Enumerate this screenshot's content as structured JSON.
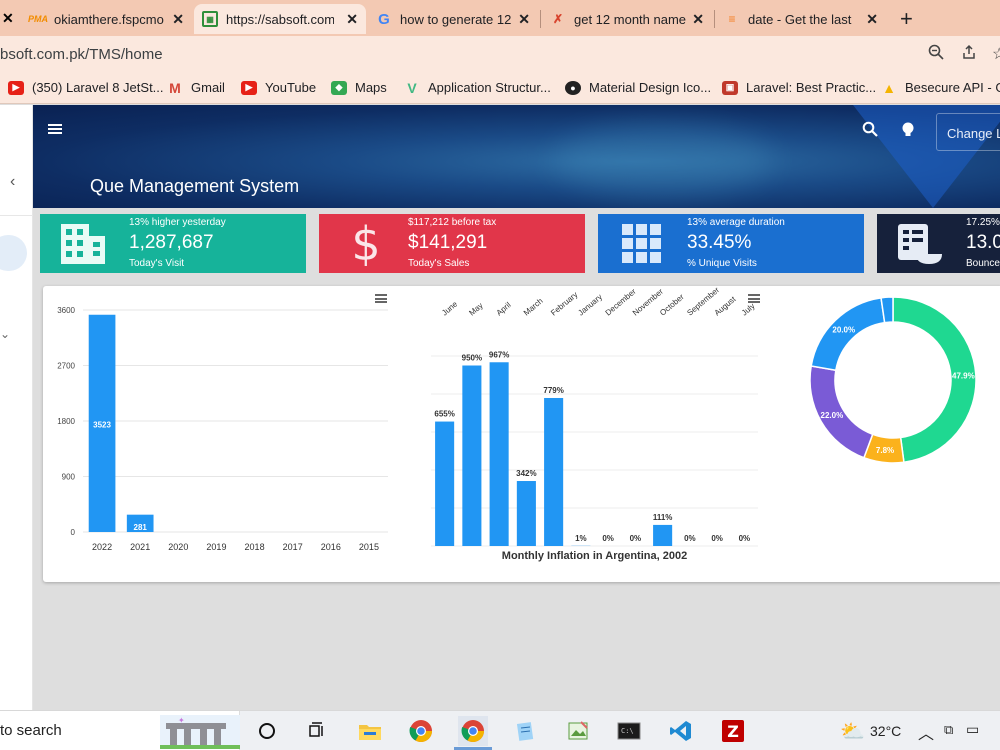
{
  "browser": {
    "tabs": [
      {
        "label": "okiamthere.fspcmo",
        "icon": "phpmyadmin-icon",
        "active": false
      },
      {
        "label": "https://sabsoft.com",
        "icon": "site-icon",
        "active": true
      },
      {
        "label": "how to generate 12",
        "icon": "google-icon",
        "active": false
      },
      {
        "label": "get 12 month name",
        "icon": "stackoverflow-icon",
        "active": false
      },
      {
        "label": "date - Get the last",
        "icon": "stackoverflow-icon",
        "active": false
      }
    ],
    "url": "bsoft.com.pk/TMS/home",
    "bookmarks": [
      {
        "label": "(350) Laravel 8 JetSt...",
        "icon": "youtube-icon",
        "color": "#e62117"
      },
      {
        "label": "Gmail",
        "icon": "gmail-icon",
        "color": "#d44638"
      },
      {
        "label": "YouTube",
        "icon": "youtube-icon",
        "color": "#e62117"
      },
      {
        "label": "Maps",
        "icon": "maps-icon",
        "color": "#34a853"
      },
      {
        "label": "Application Structur...",
        "icon": "vue-icon",
        "color": "#41b883"
      },
      {
        "label": "Material Design Ico...",
        "icon": "github-icon",
        "color": "#222222"
      },
      {
        "label": "Laravel: Best Practic...",
        "icon": "laravel-icon",
        "color": "#c0392b"
      },
      {
        "label": "Besecure API - Go",
        "icon": "drive-icon",
        "color": "#f4b400"
      }
    ]
  },
  "header": {
    "title": "Que Management System",
    "change_label": "Change L"
  },
  "cards": [
    {
      "top": "13% higher yesterday",
      "value": "1,287,687",
      "label": "Today's Visit",
      "color": "#16b39a",
      "icon": "building-icon"
    },
    {
      "top": "$117,212 before tax",
      "value": "$141,291",
      "label": "Today's Sales",
      "color": "#e1364a",
      "icon": "dollar-icon"
    },
    {
      "top": "13% average duration",
      "value": "33.45%",
      "label": "% Unique Visits",
      "color": "#1a6fd0",
      "icon": "grid-icon"
    },
    {
      "top": "17.25%",
      "value": "13.0",
      "label": "Bounce",
      "color": "#16213b",
      "icon": "receipt-icon"
    }
  ],
  "chart_data": [
    {
      "type": "bar",
      "categories": [
        "2022",
        "2021",
        "2020",
        "2019",
        "2018",
        "2017",
        "2016",
        "2015"
      ],
      "values": [
        3523,
        281,
        0,
        0,
        0,
        0,
        0,
        0
      ],
      "data_labels": [
        "3523",
        "281",
        "",
        "",
        "",
        "",
        "",
        ""
      ],
      "ytick_labels": [
        "0",
        "900",
        "1800",
        "2700",
        "3600"
      ],
      "ylim": [
        0,
        3600
      ],
      "color": "#2196f3",
      "grid": true
    },
    {
      "type": "bar",
      "title": "Monthly Inflation in Argentina, 2002",
      "categories": [
        "June",
        "May",
        "April",
        "March",
        "February",
        "January",
        "December",
        "November",
        "October",
        "September",
        "August",
        "July"
      ],
      "values": [
        655,
        950,
        967,
        342,
        779,
        1,
        0,
        0,
        111,
        0,
        0,
        0
      ],
      "data_labels": [
        "655%",
        "950%",
        "967%",
        "342%",
        "779%",
        "1%",
        "0%",
        "0%",
        "111%",
        "0%",
        "0%",
        "0%"
      ],
      "ylim": [
        0,
        1000
      ],
      "color": "#2196f3",
      "grid": true,
      "xaxis_position": "top"
    },
    {
      "type": "pie",
      "donut": true,
      "values": [
        47.9,
        7.8,
        22.0,
        20.0,
        2.3
      ],
      "labels": [
        "47.9%",
        "7.8%",
        "22.0%",
        "20.0%",
        ""
      ],
      "colors": [
        "#1fd891",
        "#fbb21c",
        "#7a5bd6",
        "#2196f3",
        "#2196f3"
      ]
    }
  ],
  "taskbar": {
    "search_text": "to search",
    "temperature": "32°C"
  }
}
